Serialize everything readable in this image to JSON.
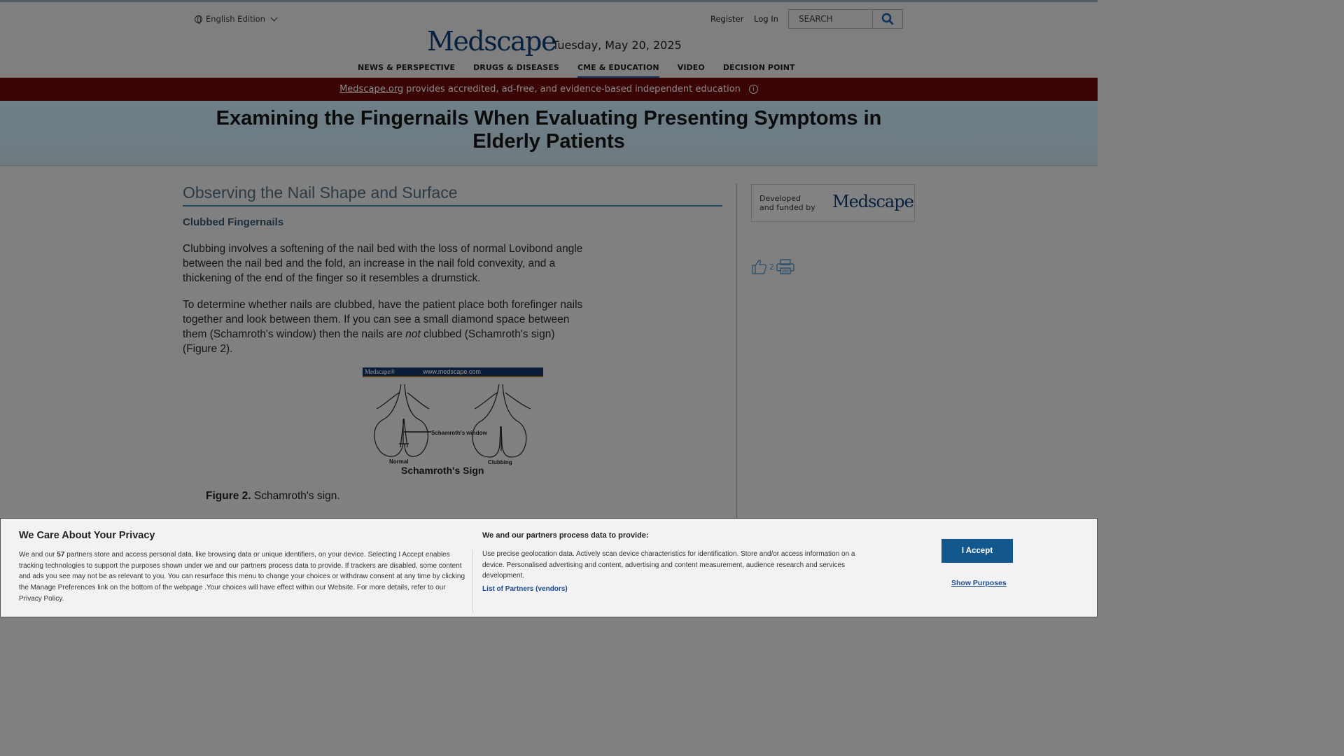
{
  "header": {
    "edition": "English Edition",
    "register": "Register",
    "login": "Log In",
    "search_placeholder": "SEARCH",
    "logo_text": "Medscape",
    "date": "Tuesday, May 20, 2025"
  },
  "nav": {
    "items": [
      {
        "label": "NEWS & PERSPECTIVE"
      },
      {
        "label": "DRUGS & DISEASES"
      },
      {
        "label": "CME & EDUCATION"
      },
      {
        "label": "VIDEO"
      },
      {
        "label": "DECISION POINT"
      }
    ],
    "active": "CME & EDUCATION"
  },
  "banner": {
    "link": "Medscape.org",
    "text": "provides accredited, ad-free, and evidence-based independent education"
  },
  "article": {
    "title": "Examining the Fingernails When Evaluating Presenting Symptoms in Elderly Patients",
    "section": "Observing the Nail Shape and Surface",
    "subheading": "Clubbed Fingernails",
    "p1": "Clubbing involves a softening of the nail bed with the loss of normal Lovibond angle between the nail bed and the fold, an increase in the nail fold convexity, and a thickening of the end of the finger so it resembles a drumstick.",
    "p2_before": "To determine whether nails are clubbed, have the patient place both forefinger nails together and look between them. If you can see a small diamond space between them (Schamroth's window) then the nails are ",
    "p2_em": "not",
    "p2_after": " clubbed (Schamroth's sign) (Figure 2).",
    "figure": {
      "bar_left": "Medscape®",
      "bar_right": "www.medscape.com",
      "label_window": "Schamroth's window",
      "label_normal": "Normal",
      "label_clubbing": "Clubbing",
      "label_title": "Schamroth's Sign",
      "caption_label": "Figure 2.",
      "caption_text": "Schamroth's sign."
    }
  },
  "sidebar": {
    "sponsor_text": "Developed and funded by",
    "sponsor_logo": "Medscape",
    "like_count": "2"
  },
  "privacy": {
    "title": "We Care About Your Privacy",
    "body_1": "We and our ",
    "partner_count": "57",
    "body_2": " partners store and access personal data, like browsing data or unique identifiers, on your device. Selecting I Accept enables tracking technologies to support the purposes shown under we and our partners process data to provide. If trackers are disabled, some content and ads you see may not be as relevant to you. You can resurface this menu to change your choices or withdraw consent at any time by clicking the Manage Preferences link on the bottom of the webpage .Your choices will have effect within our Website. For more details, refer to our Privacy Policy.",
    "heading2": "We and our partners process data to provide:",
    "body2": "Use precise geolocation data. Actively scan device characteristics for identification. Store and/or access information on a device. Personalised advertising and content, advertising and content measurement, audience research and services development.",
    "partners_link": "List of Partners (vendors)",
    "accept_label": "I Accept",
    "show_purposes": "Show Purposes"
  },
  "colors": {
    "banner_bg": "#3b0404",
    "accept_bg": "#13588c",
    "logo": "#06203f"
  }
}
